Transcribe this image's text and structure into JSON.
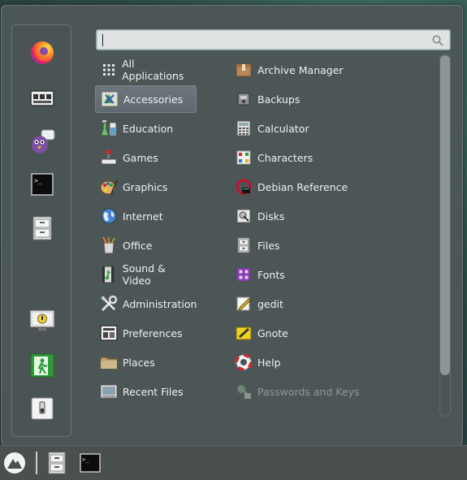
{
  "search": {
    "value": "",
    "placeholder": ""
  },
  "favorites": [
    {
      "name": "firefox-icon"
    },
    {
      "name": "drive-manager-icon"
    },
    {
      "name": "pidgin-icon"
    },
    {
      "name": "terminal-icon"
    },
    {
      "name": "file-cabinet-icon"
    },
    {
      "name": "lock-screen-icon"
    },
    {
      "name": "logout-icon"
    },
    {
      "name": "shutdown-icon"
    }
  ],
  "categories": [
    {
      "label": "All Applications",
      "icon": "grid-icon"
    },
    {
      "label": "Accessories",
      "icon": "accessories-icon",
      "selected": true
    },
    {
      "label": "Education",
      "icon": "education-icon"
    },
    {
      "label": "Games",
      "icon": "games-icon"
    },
    {
      "label": "Graphics",
      "icon": "graphics-icon"
    },
    {
      "label": "Internet",
      "icon": "internet-icon"
    },
    {
      "label": "Office",
      "icon": "office-icon"
    },
    {
      "label": "Sound & Video",
      "icon": "sound-video-icon"
    },
    {
      "label": "Administration",
      "icon": "administration-icon"
    },
    {
      "label": "Preferences",
      "icon": "preferences-icon"
    },
    {
      "label": "Places",
      "icon": "folder-icon"
    },
    {
      "label": "Recent Files",
      "icon": "recent-files-icon"
    }
  ],
  "apps": [
    {
      "label": "Archive Manager",
      "icon": "archive-icon"
    },
    {
      "label": "Backups",
      "icon": "backups-icon"
    },
    {
      "label": "Calculator",
      "icon": "calculator-icon"
    },
    {
      "label": "Characters",
      "icon": "characters-icon"
    },
    {
      "label": "Debian Reference",
      "icon": "debian-icon"
    },
    {
      "label": "Disks",
      "icon": "disks-icon"
    },
    {
      "label": "Files",
      "icon": "file-cabinet-icon"
    },
    {
      "label": "Fonts",
      "icon": "fonts-icon"
    },
    {
      "label": "gedit",
      "icon": "text-editor-icon"
    },
    {
      "label": "Gnote",
      "icon": "notes-icon"
    },
    {
      "label": "Help",
      "icon": "help-icon"
    },
    {
      "label": "Passwords and Keys",
      "icon": "keys-icon",
      "dim": true
    }
  ],
  "panel": [
    {
      "name": "menu-icon"
    },
    {
      "name": "file-cabinet-icon"
    },
    {
      "name": "terminal-icon"
    }
  ]
}
